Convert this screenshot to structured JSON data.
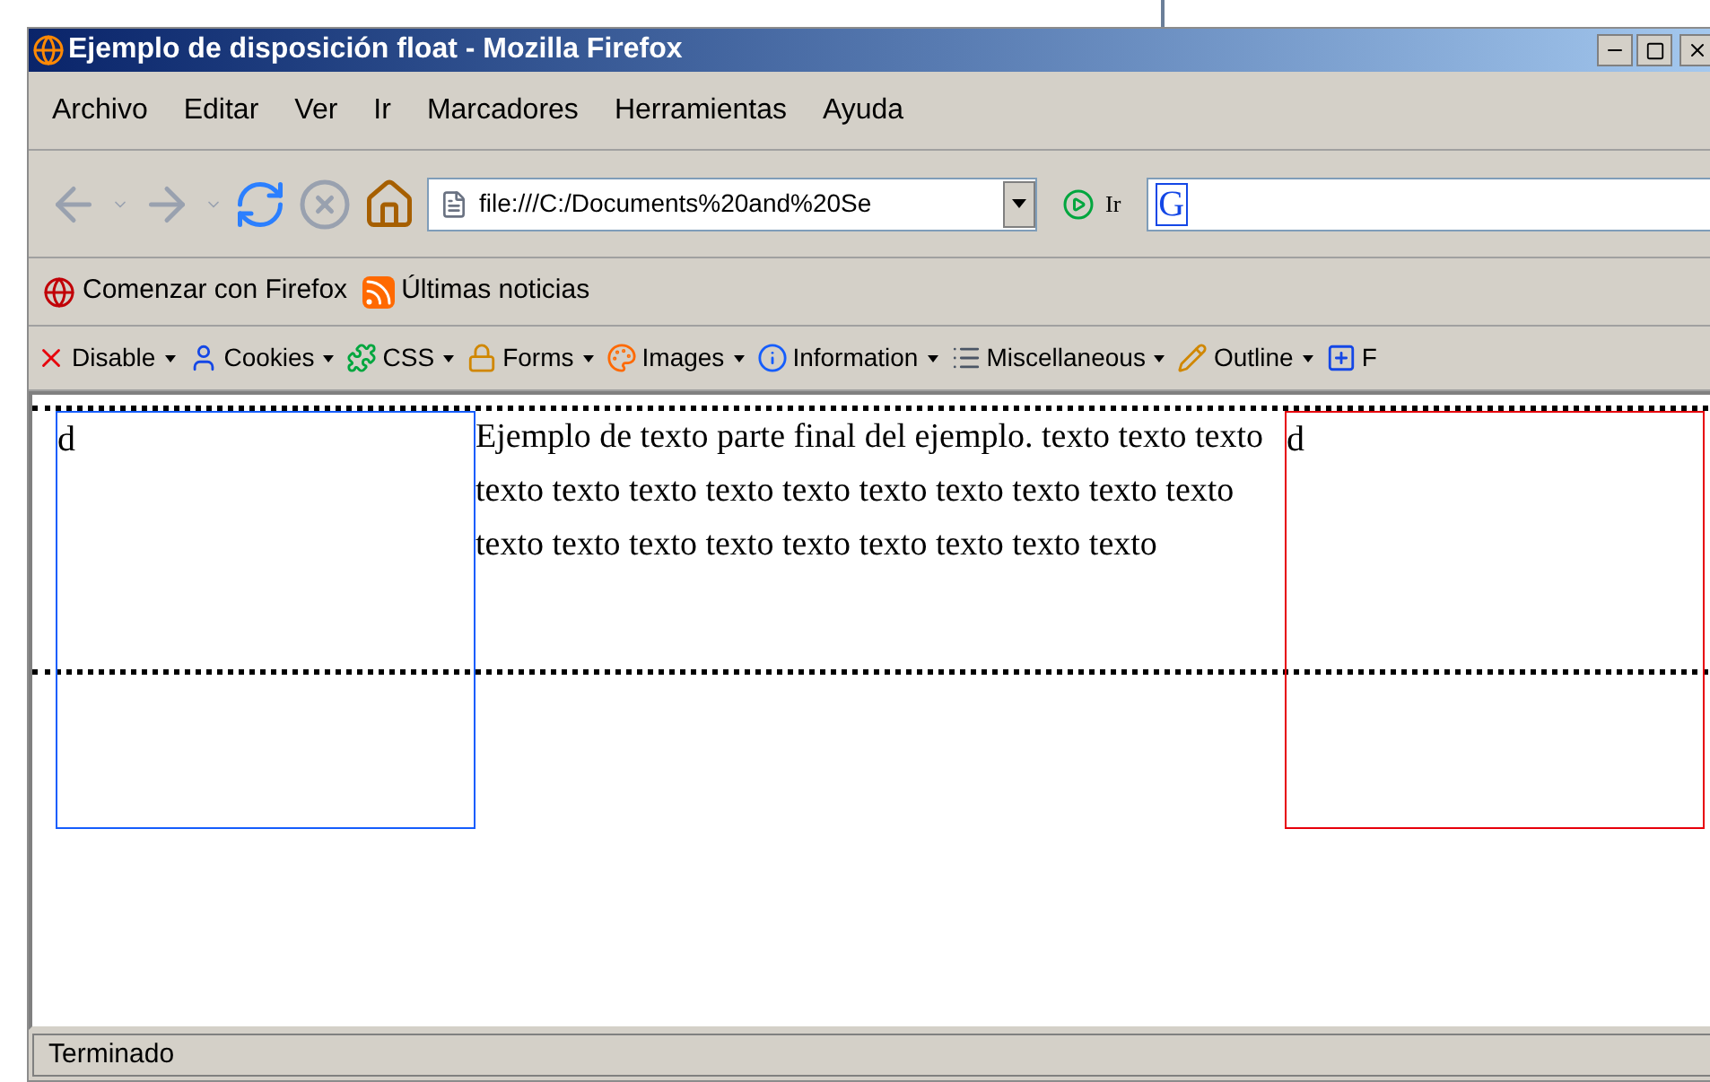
{
  "window": {
    "title": "Ejemplo de disposición float - Mozilla Firefox"
  },
  "menu": [
    "Archivo",
    "Editar",
    "Ver",
    "Ir",
    "Marcadores",
    "Herramientas",
    "Ayuda"
  ],
  "nav": {
    "url": "file:///C:/Documents%20and%20Se",
    "go": "Ir",
    "search_logo": "G"
  },
  "bookmarks": [
    {
      "label": "Comenzar con Firefox",
      "kind": "page"
    },
    {
      "label": "Últimas noticias",
      "kind": "feed"
    }
  ],
  "devtools": [
    {
      "label": "Disable",
      "kind": "disable",
      "dropdown": true
    },
    {
      "label": "Cookies",
      "kind": "cookies",
      "dropdown": true
    },
    {
      "label": "CSS",
      "kind": "css",
      "dropdown": true
    },
    {
      "label": "Forms",
      "kind": "forms",
      "dropdown": true
    },
    {
      "label": "Images",
      "kind": "images",
      "dropdown": true
    },
    {
      "label": "Information",
      "kind": "info",
      "dropdown": true
    },
    {
      "label": "Miscellaneous",
      "kind": "misc",
      "dropdown": true
    },
    {
      "label": "Outline",
      "kind": "outline",
      "dropdown": true
    },
    {
      "label": "F",
      "kind": "resize",
      "dropdown": false
    }
  ],
  "content": {
    "left_box": "d",
    "paragraph": "Ejemplo de texto parte final del ejemplo. texto texto texto texto texto texto texto texto texto texto texto texto texto texto texto texto texto texto texto texto texto texto",
    "right_box": "d"
  },
  "status_bar": "Terminado"
}
